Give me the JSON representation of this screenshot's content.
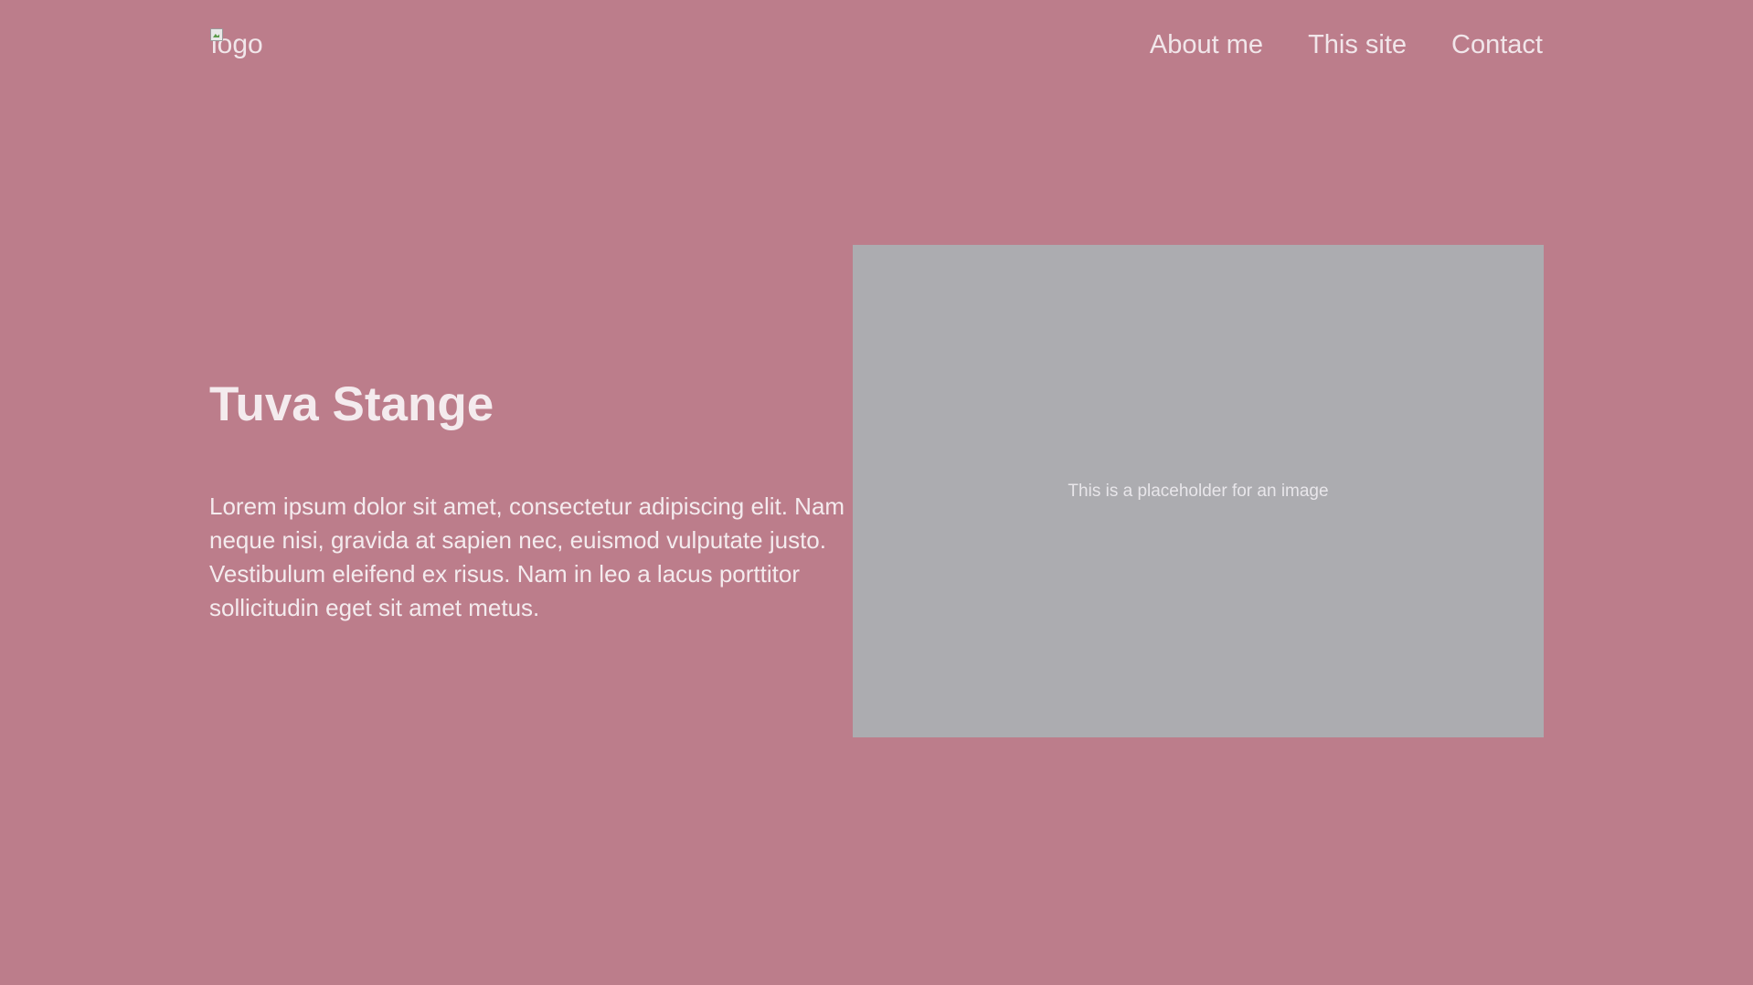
{
  "colors": {
    "background": "#bc7d8b",
    "text": "#f1e6ea",
    "placeholder_bg": "#acacb0",
    "placeholder_text": "#e8e6ea"
  },
  "header": {
    "logo_alt": "logo",
    "logo_icon": "broken-image-icon",
    "nav": [
      {
        "label": "About me"
      },
      {
        "label": "This site"
      },
      {
        "label": "Contact"
      }
    ]
  },
  "hero": {
    "title": "Tuva Stange",
    "body": "Lorem ipsum dolor sit amet, consectetur adipiscing elit. Nam neque nisi, gravida at sapien nec, euismod vulputate justo. Vestibulum eleifend ex risus. Nam in leo a lacus porttitor sollicitudin eget sit amet metus.",
    "image_placeholder": "This is a placeholder for an image"
  }
}
